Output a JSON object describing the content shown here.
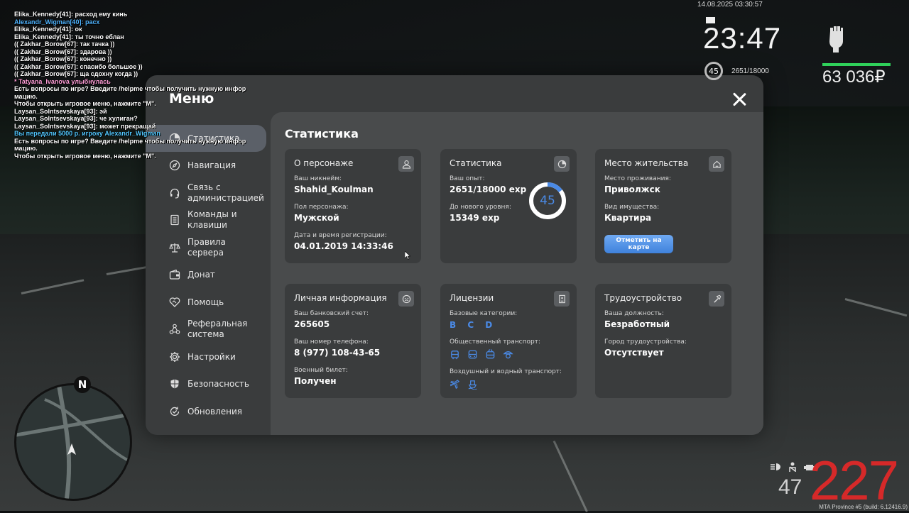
{
  "chat": [
    {
      "text": "Elika_Kennedy[41]: расход ему кинь",
      "color": "white"
    },
    {
      "text": "Alexandr_Wigman[40]: расх",
      "color": "blue"
    },
    {
      "text": "Elika_Kennedy[41]: ок",
      "color": "white"
    },
    {
      "text": "Elika_Kennedy[41]: ты точно еблан",
      "color": "white"
    },
    {
      "text": "(( Zakhar_Borow[67]: так тачка ))",
      "color": "white"
    },
    {
      "text": "(( Zakhar_Borow[67]: здарова ))",
      "color": "white"
    },
    {
      "text": "(( Zakhar_Borow[67]: конечно ))",
      "color": "white"
    },
    {
      "text": "(( Zakhar_Borow[67]: спасибо большое ))",
      "color": "white"
    },
    {
      "text": "(( Zakhar_Borow[67]: ща сдохну когда ))",
      "color": "white"
    },
    {
      "text": "* Tatyana_Ivanova улыбнулась",
      "color": "pink"
    },
    {
      "text": "Есть вопросы по игре? Введите /helpme чтобы получить нужную инфор",
      "color": "white"
    },
    {
      "text": "мацию.",
      "color": "white"
    },
    {
      "text": "Чтобы открыть игровое меню, нажмите \"M\".",
      "color": "white"
    },
    {
      "text": "Laysan_Solntsevskaya[93]: эй",
      "color": "white"
    },
    {
      "text": "Laysan_Solntsevskaya[93]: че хулиган?",
      "color": "white"
    },
    {
      "text": "Laysan_Solntsevskaya[93]: может прекращай",
      "color": "white"
    },
    {
      "text": "Вы передали 5000 р. игроку Alexandr_Wigman",
      "color": "cyan"
    },
    {
      "text": "Есть вопросы по игре? Введите /helpme чтобы получить нужную инфор",
      "color": "white"
    },
    {
      "text": "мацию.",
      "color": "white"
    },
    {
      "text": "Чтобы открыть игровое меню, нажмите \"M\".",
      "color": "white"
    }
  ],
  "hud": {
    "datetime": "14.08.2025 03:30:57",
    "clock": "23:47",
    "level": "45",
    "exp": "2651/18000",
    "money": "63 036₽",
    "health_percent": 100,
    "speed": "227",
    "fuel": "47",
    "build": "MTA Province #5 (build: 6.12416.9)",
    "minimap_north": "N"
  },
  "menu": {
    "title": "Меню",
    "sidebar": [
      {
        "label": "Статистика",
        "icon": "pie-chart-icon",
        "active": true
      },
      {
        "label": "Навигация",
        "icon": "compass-icon",
        "active": false
      },
      {
        "label": "Связь с администрацией",
        "icon": "headset-icon",
        "active": false
      },
      {
        "label": "Команды и клавиши",
        "icon": "document-icon",
        "active": false
      },
      {
        "label": "Правила сервера",
        "icon": "scales-icon",
        "active": false
      },
      {
        "label": "Донат",
        "icon": "wallet-icon",
        "active": false
      },
      {
        "label": "Помощь",
        "icon": "heart-handshake-icon",
        "active": false
      },
      {
        "label": "Реферальная система",
        "icon": "network-icon",
        "active": false
      },
      {
        "label": "Настройки",
        "icon": "gear-icon",
        "active": false
      },
      {
        "label": "Безопасность",
        "icon": "shield-icon",
        "active": false
      },
      {
        "label": "Обновления",
        "icon": "refresh-check-icon",
        "active": false
      }
    ],
    "content_title": "Статистика",
    "cards": {
      "character": {
        "title": "О персонаже",
        "nick_label": "Ваш никнейм:",
        "nick": "Shahid_Koulman",
        "gender_label": "Пол персонажа:",
        "gender": "Мужской",
        "reg_label": "Дата и время регистрации:",
        "reg": "04.01.2019 14:33:46"
      },
      "stats": {
        "title": "Статистика",
        "exp_label": "Ваш опыт:",
        "exp": "2651/18000 exp",
        "next_label": "До нового уровня:",
        "next": "15349 exp",
        "level": "45",
        "progress": 0.147,
        "accent": "#4a8ae6"
      },
      "residence": {
        "title": "Место жительства",
        "place_label": "Место проживания:",
        "place": "Приволжск",
        "property_label": "Вид имущества:",
        "property": "Квартира",
        "button": "Отметить на карте"
      },
      "personal": {
        "title": "Личная информация",
        "bank_label": "Ваш банковский счет:",
        "bank": "265605",
        "phone_label": "Ваш номер телефона:",
        "phone": "8 (977) 108-43-65",
        "military_label": "Военный билет:",
        "military": "Получен"
      },
      "licenses": {
        "title": "Лицензии",
        "basic_label": "Базовые категории:",
        "basic": "B C D",
        "public_label": "Общественный транспорт:",
        "air_label": "Воздушный и водный транспорт:"
      },
      "employment": {
        "title": "Трудоустройство",
        "position_label": "Ваша должность:",
        "position": "Безработный",
        "city_label": "Город трудоустройства:",
        "city": "Отсутствует"
      }
    }
  }
}
